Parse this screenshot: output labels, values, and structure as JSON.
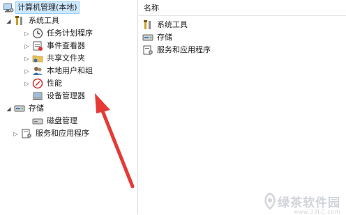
{
  "tree": {
    "root": {
      "label": "计算机管理(本地)",
      "icon": "computer-management-icon"
    },
    "system_tools": {
      "label": "系统工具",
      "icon": "tools-icon"
    },
    "task_scheduler": {
      "label": "任务计划程序",
      "icon": "clock-icon"
    },
    "event_viewer": {
      "label": "事件查看器",
      "icon": "event-viewer-icon"
    },
    "shared_folders": {
      "label": "共享文件夹",
      "icon": "shared-folder-icon"
    },
    "local_users": {
      "label": "本地用户和组",
      "icon": "users-icon"
    },
    "performance": {
      "label": "性能",
      "icon": "performance-icon"
    },
    "device_manager": {
      "label": "设备管理器",
      "icon": "device-manager-icon"
    },
    "storage": {
      "label": "存储",
      "icon": "storage-icon"
    },
    "disk_management": {
      "label": "磁盘管理",
      "icon": "disk-icon"
    },
    "services_apps": {
      "label": "服务和应用程序",
      "icon": "services-icon"
    }
  },
  "list": {
    "column_name": "名称",
    "items": [
      {
        "label": "系统工具",
        "icon": "tools-icon"
      },
      {
        "label": "存储",
        "icon": "storage-icon"
      },
      {
        "label": "服务和应用程序",
        "icon": "services-icon"
      }
    ]
  },
  "watermark": {
    "text": "绿茶软件园",
    "url": "www.33LC.com"
  },
  "colors": {
    "arrow": "#e53a35",
    "selection": "#cde8ff"
  }
}
